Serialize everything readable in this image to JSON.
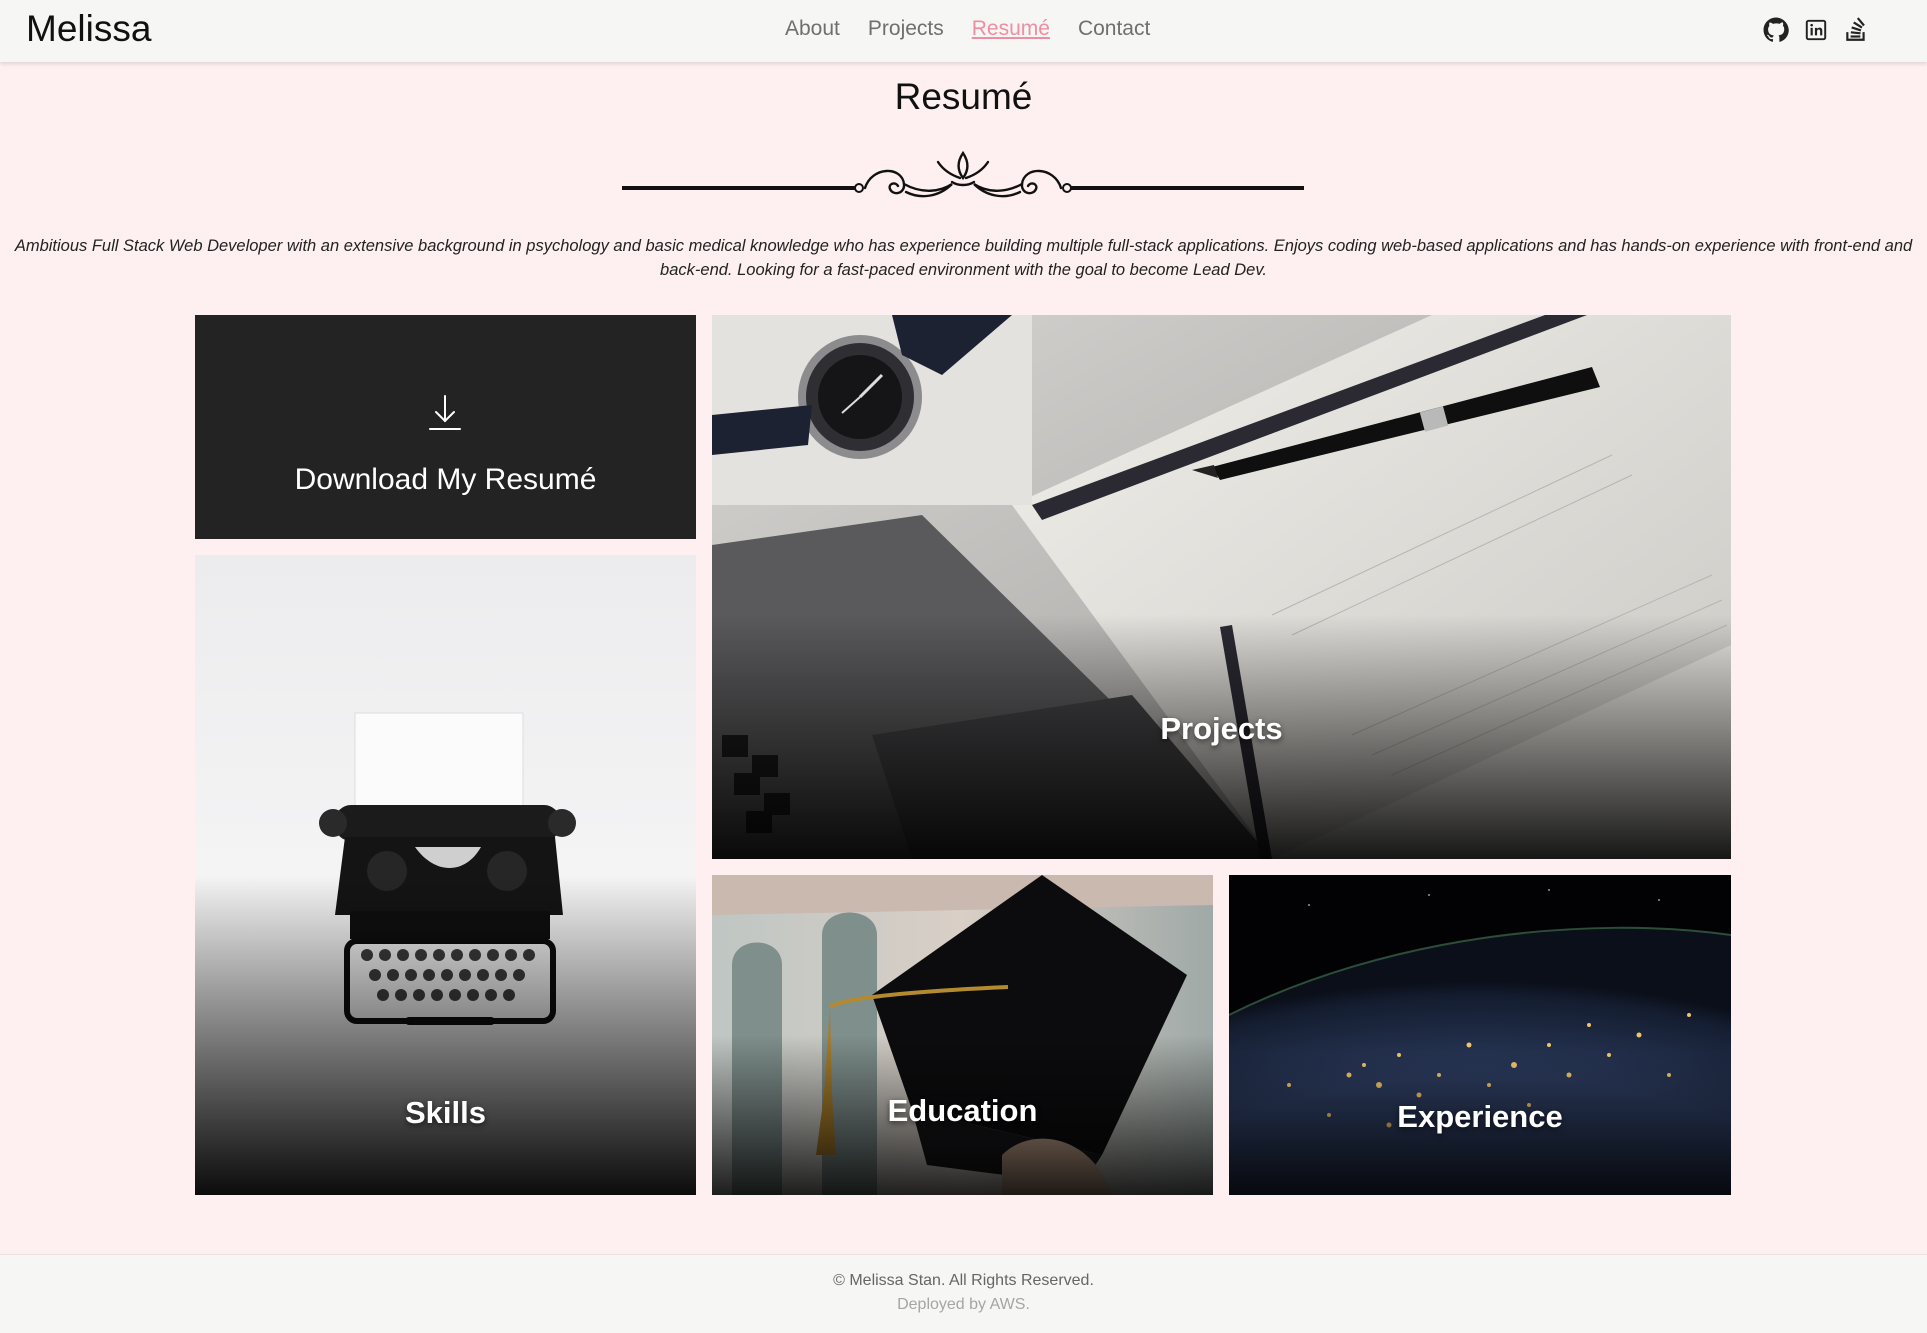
{
  "navbar": {
    "brand": "Melissa",
    "links": [
      {
        "label": "About"
      },
      {
        "label": "Projects"
      },
      {
        "label": "Resumé"
      },
      {
        "label": "Contact"
      }
    ],
    "active": "Resumé",
    "social_icons": [
      "github-icon",
      "linkedin-icon",
      "stack-overflow-icon"
    ]
  },
  "header": {
    "title": "Resumé",
    "summary": "Ambitious Full Stack Web Developer with an extensive background in psychology and basic medical knowledge who has experience building multiple full-stack applications. Enjoys coding web-based applications and has hands-on experience with front-end and back-end. Looking for a fast-paced environment with the goal to become Lead Dev."
  },
  "tiles": {
    "download": {
      "label": "Download My Resumé",
      "icon": "download-arrow-icon"
    },
    "skills": {
      "label": "Skills"
    },
    "projects": {
      "label": "Projects"
    },
    "education": {
      "label": "Education"
    },
    "experience": {
      "label": "Experience"
    }
  },
  "footer": {
    "copyright": "© Melissa Stan. All Rights Reserved.",
    "deployed": "Deployed by AWS."
  },
  "colors": {
    "background": "#fef0f0",
    "navbar": "#f6f6f5",
    "active_link": "#ef8ea0",
    "download_tile": "#232323"
  }
}
